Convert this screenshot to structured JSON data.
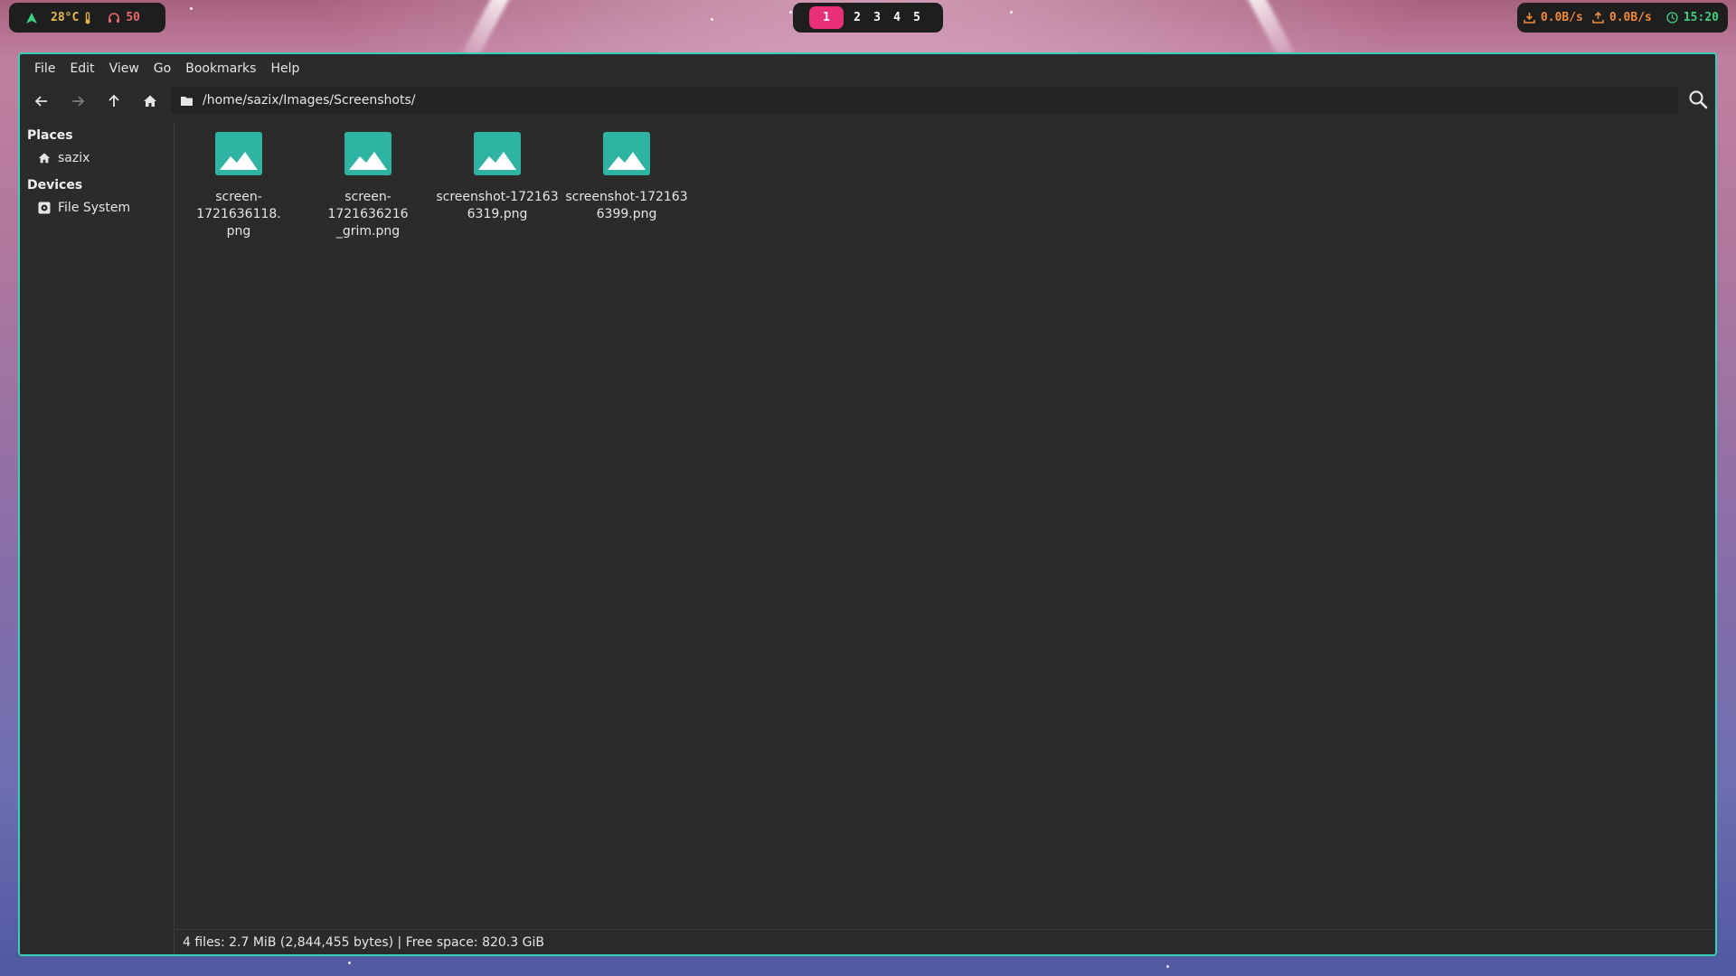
{
  "topbar": {
    "left": {
      "temperature": "28°C",
      "volume": "50"
    },
    "workspaces": [
      "1",
      "2",
      "3",
      "4",
      "5"
    ],
    "active_workspace": "1",
    "right": {
      "download": "0.0B/s",
      "upload": "0.0B/s",
      "clock": "15:20"
    },
    "colors": {
      "active_ws": "#e8307a",
      "arch": "#3dd07e",
      "temp": "#e8b84a",
      "volume": "#e86a6a",
      "net": "#f08a3a",
      "clock": "#3dd07e"
    }
  },
  "window": {
    "menu": [
      "File",
      "Edit",
      "View",
      "Go",
      "Bookmarks",
      "Help"
    ],
    "toolbar": {
      "back_icon": "arrow-left-icon",
      "forward_icon": "arrow-right-icon",
      "up_icon": "arrow-up-icon",
      "home_icon": "home-icon",
      "search_icon": "search-icon"
    },
    "path": "/home/sazix/Images/Screenshots/",
    "sidebar": {
      "places_heading": "Places",
      "places": [
        {
          "label": "sazix",
          "icon": "home-icon"
        }
      ],
      "devices_heading": "Devices",
      "devices": [
        {
          "label": "File System",
          "icon": "drive-icon"
        }
      ]
    },
    "files": [
      {
        "line1": "screen-1721636118.",
        "line2": "png",
        "icon": "image-icon"
      },
      {
        "line1": "screen-1721636216",
        "line2": "_grim.png",
        "icon": "image-icon"
      },
      {
        "line1": "screenshot-172163",
        "line2": "6319.png",
        "icon": "image-icon"
      },
      {
        "line1": "screenshot-172163",
        "line2": "6399.png",
        "icon": "image-icon"
      }
    ],
    "status": "4 files: 2.7 MiB (2,844,455 bytes) | Free space: 820.3 GiB",
    "accent": "#35d0b8"
  }
}
